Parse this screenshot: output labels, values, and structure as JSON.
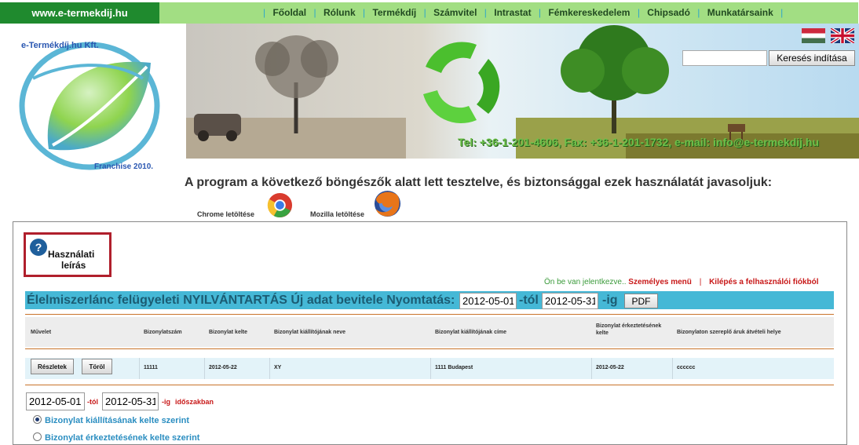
{
  "header": {
    "site_name": "www.e-termekdij.hu",
    "nav": [
      "Főoldal",
      "Rólunk",
      "Termékdíj",
      "Számvitel",
      "Intrastat",
      "Fémkereskedelem",
      "Chipsadó",
      "Munkatársaink"
    ]
  },
  "logo": {
    "company": "e-Termékdíj.hu Kft.",
    "franchise": "Franchise 2010."
  },
  "banner": {
    "contact": "Tel: +36-1-201-4606, Fax: +36-1-201-1732, e-mail: info@e-termekdij.hu"
  },
  "search": {
    "value": "",
    "button_label": "Keresés indítása"
  },
  "browser_notice": {
    "text": "A program a következő böngészők alatt lett tesztelve, és biztonsággal ezek használatát javasoljuk:",
    "chrome_label": "Chrome letöltése",
    "mozilla_label": "Mozilla letöltése"
  },
  "help": {
    "line1": "Használati",
    "line2": "leírás"
  },
  "user_bar": {
    "status": "Ön be van jelentkezve..",
    "menu_link": "Személyes menü",
    "separator": "|",
    "logout_link": "Kilépés a felhasználói fiókból"
  },
  "title_bar": {
    "title": "Élelmiszerlánc felügyeleti NYILVÁNTARTÁS  Új adat bevitele  Nyomtatás:",
    "date_from": "2012-05-01",
    "from_suffix": "-tól",
    "date_to": "2012-05-31",
    "to_suffix": "-ig",
    "pdf_label": "PDF"
  },
  "table": {
    "headers": [
      "Művelet",
      "Bizonylatszám",
      "Bizonylat kelte",
      "Bizonylat kiállítójának neve",
      "Bizonylat kiállítójának címe",
      "Bizonylat érkeztetésének kelte",
      "Bizonylaton szereplő áruk átvételi helye"
    ],
    "rows": [
      {
        "details_label": "Részletek",
        "delete_label": "Töröl",
        "number": "11111",
        "date": "2012-05-22",
        "issuer_name": "XY",
        "issuer_address": "1111 Budapest",
        "arrival_date": "2012-05-22",
        "place": "cccccc"
      }
    ]
  },
  "period": {
    "from": "2012-05-01",
    "from_suffix": "-tól",
    "to": "2012-05-31",
    "to_suffix": "-ig",
    "suffix": "időszakban",
    "options": [
      {
        "label": "Bizonylat kiállításának kelte szerint",
        "checked": true
      },
      {
        "label": "Bizonylat érkeztetésének kelte szerint",
        "checked": false
      }
    ]
  },
  "colors": {
    "brand_green": "#1f8a2e",
    "nav_green": "#a2de83",
    "title_blue": "#45b8d6",
    "accent_red": "#c81919",
    "divider": "#c8732a"
  }
}
